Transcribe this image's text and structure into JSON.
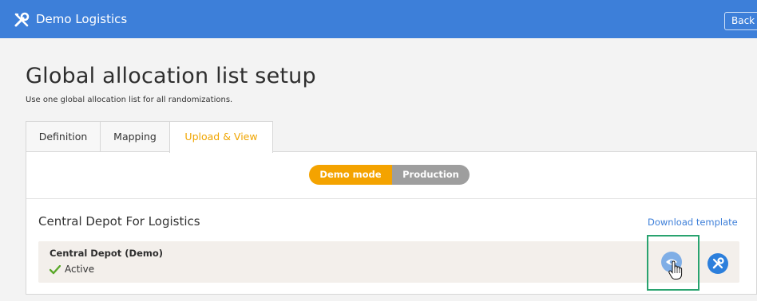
{
  "header": {
    "app_title": "Demo Logistics",
    "back_label": "Back",
    "logo_icon": "tools-icon"
  },
  "page": {
    "title": "Global allocation list setup",
    "subtitle": "Use one global allocation list for all randomizations."
  },
  "tabs": [
    {
      "label": "Definition",
      "active": false
    },
    {
      "label": "Mapping",
      "active": false
    },
    {
      "label": "Upload & View",
      "active": true
    }
  ],
  "mode_toggle": {
    "demo_label": "Demo mode",
    "production_label": "Production",
    "selected": "Demo mode"
  },
  "depot_section": {
    "title": "Central Depot For Logistics",
    "download_link": "Download template",
    "depot": {
      "name": "Central Depot (Demo)",
      "status": "Active",
      "status_icon": "checkmark-icon",
      "actions": [
        "eye-icon",
        "tools-icon"
      ]
    }
  },
  "colors": {
    "header_bg": "#3d7fd9",
    "accent": "#f4a300",
    "production": "#9e9e9e",
    "link": "#3d7fd9",
    "status_ok": "#5aa82a",
    "highlight": "#29a36f"
  }
}
